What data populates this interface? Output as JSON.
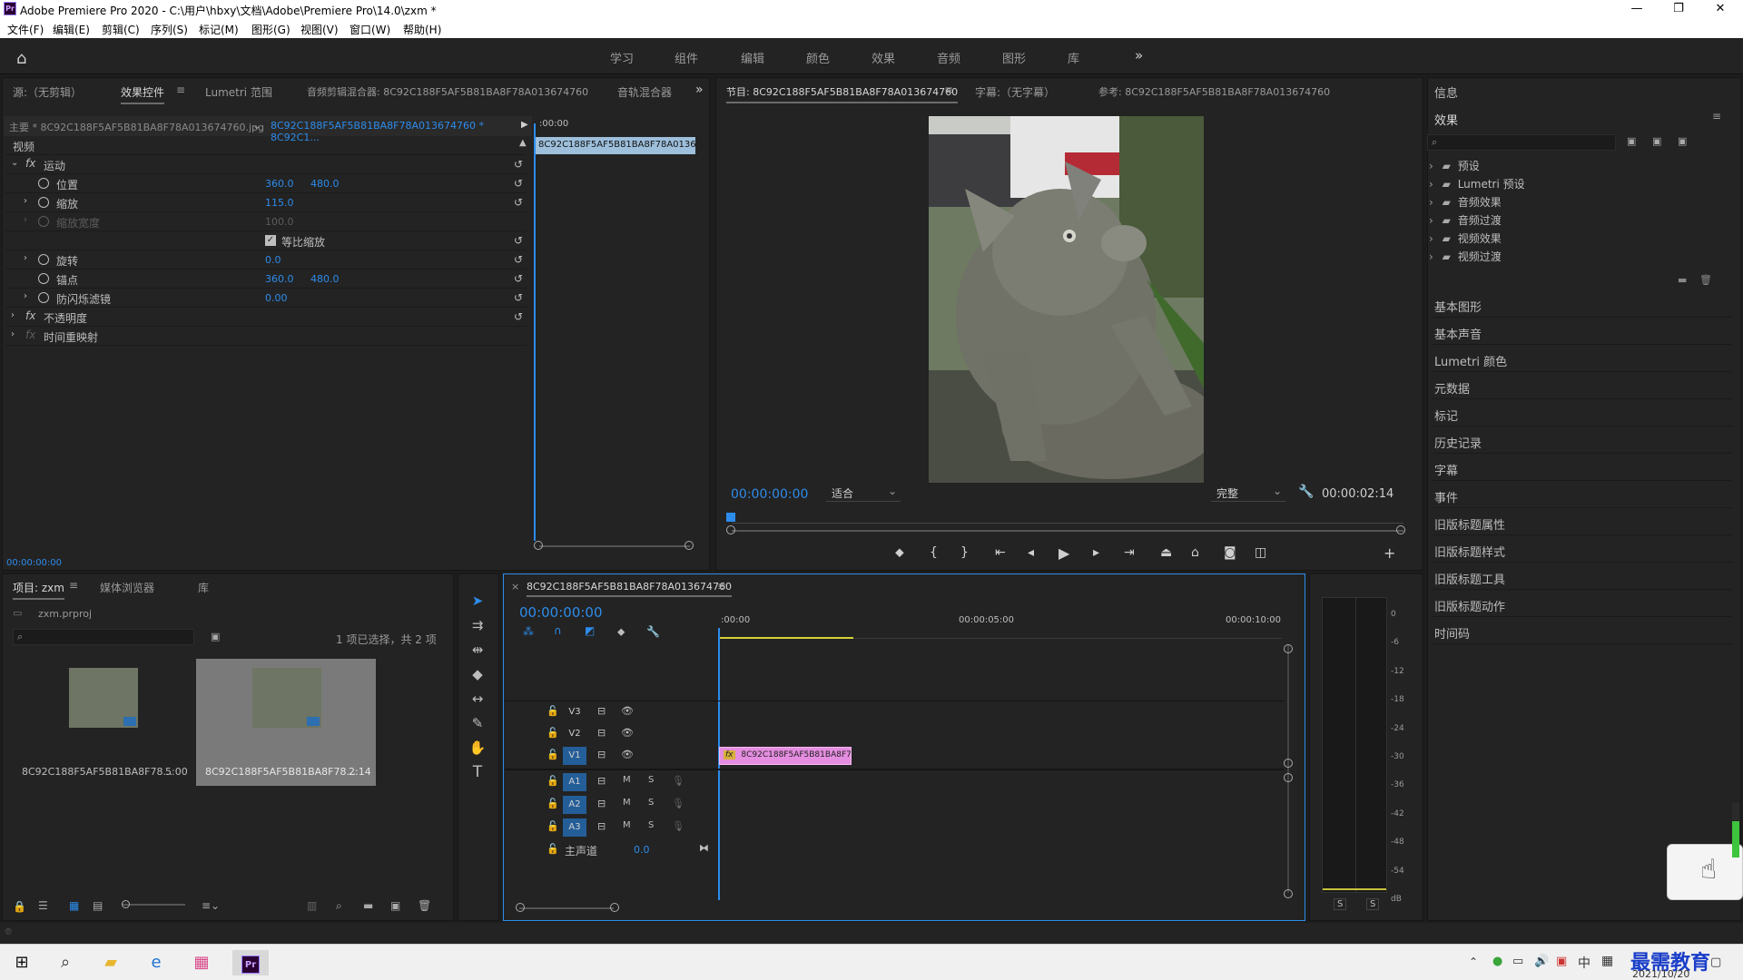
{
  "window": {
    "title": "Adobe Premiere Pro 2020 - C:\\用户\\hbxy\\文档\\Adobe\\Premiere Pro\\14.0\\zxm *",
    "app_icon": "Pr"
  },
  "menu": [
    "文件(F)",
    "编辑(E)",
    "剪辑(C)",
    "序列(S)",
    "标记(M)",
    "图形(G)",
    "视图(V)",
    "窗口(W)",
    "帮助(H)"
  ],
  "workspaces": [
    "学习",
    "组件",
    "编辑",
    "颜色",
    "效果",
    "音频",
    "图形",
    "库"
  ],
  "left_tabs": [
    "源:（无剪辑）",
    "效果控件",
    "Lumetri 范围",
    "音频剪辑混合器: 8C92C188F5AF5B81BA8F78A013674760",
    "音轨混合器"
  ],
  "effect_controls": {
    "master": "主要 * 8C92C188F5AF5B81BA8F78A013674760.jpg",
    "sequence": "8C92C188F5AF5B81BA8F78A013674760 * 8C92C1...",
    "time_ruler": ":00:00",
    "clip_bar": "8C92C188F5AF5B81BA8F78A01367",
    "section": "视频",
    "motion": "运动",
    "rows": [
      {
        "name": "位置",
        "v1": "360.0",
        "v2": "480.0"
      },
      {
        "name": "缩放",
        "v1": "115.0",
        "v2": ""
      },
      {
        "name": "缩放宽度",
        "v1": "100.0",
        "v2": ""
      },
      {
        "name": "等比缩放",
        "v1": "",
        "v2": ""
      },
      {
        "name": "旋转",
        "v1": "0.0",
        "v2": ""
      },
      {
        "name": "锚点",
        "v1": "360.0",
        "v2": "480.0"
      },
      {
        "name": "防闪烁滤镜",
        "v1": "0.00",
        "v2": ""
      }
    ],
    "opacity": "不透明度",
    "time_remap": "时间重映射",
    "timecode": "00:00:00:00"
  },
  "program": {
    "tabs": [
      "节目: 8C92C188F5AF5B81BA8F78A013674760",
      "字幕:（无字幕）",
      "参考: 8C92C188F5AF5B81BA8F78A013674760"
    ],
    "timecode": "00:00:00:00",
    "fit": "适合",
    "quality": "完整",
    "duration": "00:00:02:14"
  },
  "right_panel": {
    "info": "信息",
    "effects": "效果",
    "folders": [
      "预设",
      "Lumetri 预设",
      "音频效果",
      "音频过渡",
      "视频效果",
      "视频过渡"
    ],
    "panels": [
      "基本图形",
      "基本声音",
      "Lumetri 颜色",
      "元数据",
      "标记",
      "历史记录",
      "字幕",
      "事件",
      "旧版标题属性",
      "旧版标题样式",
      "旧版标题工具",
      "旧版标题动作",
      "时间码"
    ]
  },
  "project": {
    "tabs": [
      "项目: zxm",
      "媒体浏览器",
      "库"
    ],
    "file": "zxm.prproj",
    "selection": "1 项已选择，共 2 项",
    "items": [
      {
        "name": "8C92C188F5AF5B81BA8F78...",
        "dur": "5:00"
      },
      {
        "name": "8C92C188F5AF5B81BA8F78...",
        "dur": "2:14"
      }
    ]
  },
  "timeline": {
    "tab": "8C92C188F5AF5B81BA8F78A013674760",
    "timecode": "00:00:00:00",
    "ruler": [
      ":00:00",
      "00:00:05:00",
      "00:00:10:00"
    ],
    "video_tracks": [
      "V3",
      "V2",
      "V1"
    ],
    "audio_tracks": [
      "A1",
      "A2",
      "A3"
    ],
    "master": "主声道",
    "master_val": "0.0",
    "clip": "8C92C188F5AF5B81BA8F78"
  },
  "meter": {
    "scale": [
      "0",
      "-6",
      "-12",
      "-18",
      "-24",
      "-30",
      "-36",
      "-42",
      "-48",
      "-54",
      "dB"
    ],
    "solo": [
      "S",
      "S"
    ]
  },
  "taskbar": {
    "date": "2021/10/20",
    "ime": "中",
    "watermark": "最需教育"
  },
  "colors": {
    "accent": "#2d8ceb",
    "clip": "#e58de0",
    "bg": "#232323"
  }
}
